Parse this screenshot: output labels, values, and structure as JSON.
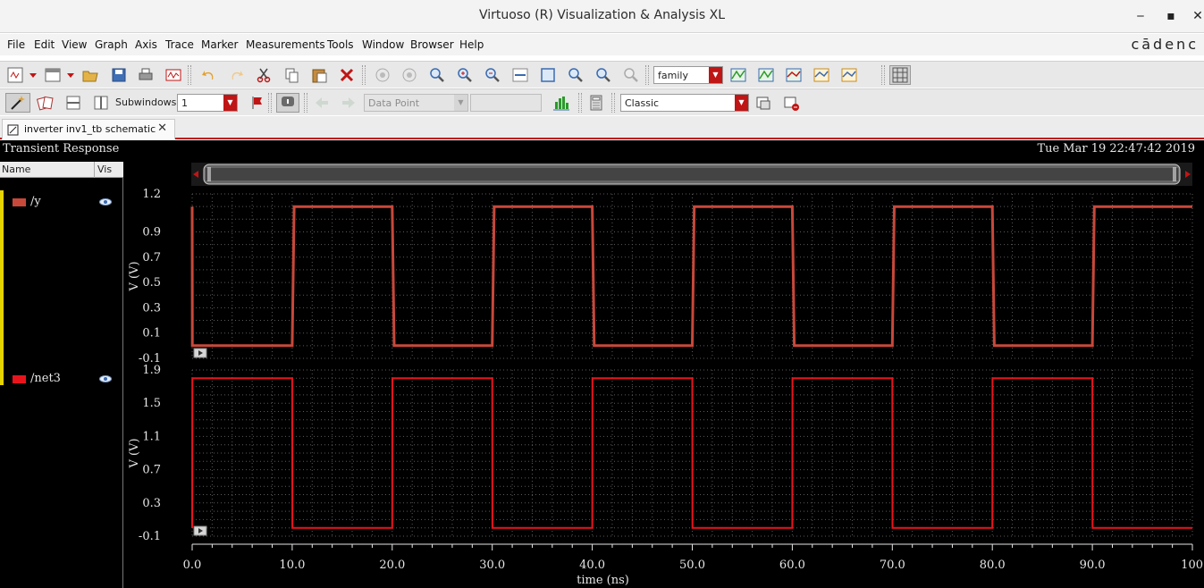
{
  "window": {
    "title": "Virtuoso (R) Visualization & Analysis XL",
    "minimize": "‒",
    "maximize": "▪",
    "close": "✕"
  },
  "menu": {
    "items": [
      "File",
      "Edit",
      "View",
      "Graph",
      "Axis",
      "Trace",
      "Marker",
      "Measurements",
      "Tools",
      "Window",
      "Browser",
      "Help"
    ],
    "logo": "cādenc"
  },
  "toolbar": {
    "family_combo": "family",
    "subwindows_label": "Subwindows:",
    "subwindows_value": "1",
    "data_point_combo": "Data Point",
    "style_combo": "Classic"
  },
  "tab": {
    "label": "inverter inv1_tb schematic",
    "close": "✕"
  },
  "plot": {
    "caption": "Transient Response",
    "date": "Tue Mar 19 22:47:42 2019"
  },
  "trace_panel": {
    "col_name": "Name",
    "col_vis": "Vis",
    "traces": [
      {
        "name": "/y",
        "color": "#c8483a"
      },
      {
        "name": "/net3",
        "color": "#e8141c"
      }
    ]
  },
  "colors": {
    "accent": "#c01515",
    "trace_y": "#c8483a",
    "trace_net3": "#e8141c",
    "grid": "#5a5a5a",
    "background": "#000000"
  },
  "chart_data": [
    {
      "type": "line",
      "series": [
        {
          "name": "/y",
          "x": [
            0,
            0.02,
            10,
            10.2,
            20,
            20.2,
            30,
            30.2,
            40,
            40.2,
            50,
            50.2,
            60,
            60.2,
            70,
            70.2,
            80,
            80.2,
            90,
            90.2,
            100
          ],
          "y": [
            1.1,
            0.0,
            0.0,
            1.1,
            1.1,
            0.0,
            0.0,
            1.1,
            1.1,
            0.0,
            0.0,
            1.1,
            1.1,
            0.0,
            0.0,
            1.1,
            1.1,
            0.0,
            0.0,
            1.1,
            1.1
          ]
        }
      ],
      "ylabel": "V (V)",
      "yticks": [
        "1.2",
        "0.9",
        "0.7",
        "0.5",
        "0.3",
        "0.1",
        "-0.1"
      ],
      "ylim": [
        -0.1,
        1.2
      ],
      "xlim": [
        0,
        100
      ],
      "grid": true
    },
    {
      "type": "line",
      "series": [
        {
          "name": "/net3",
          "x": [
            0,
            0.02,
            10,
            10.02,
            20,
            20.02,
            30,
            30.02,
            40,
            40.02,
            50,
            50.02,
            60,
            60.02,
            70,
            70.02,
            80,
            80.02,
            90,
            90.02,
            100
          ],
          "y": [
            0.0,
            1.8,
            1.8,
            0.0,
            0.0,
            1.8,
            1.8,
            0.0,
            0.0,
            1.8,
            1.8,
            0.0,
            0.0,
            1.8,
            1.8,
            0.0,
            0.0,
            1.8,
            1.8,
            0.0,
            0.0
          ]
        }
      ],
      "ylabel": "V (V)",
      "yticks": [
        "1.9",
        "1.5",
        "1.1",
        "0.7",
        "0.3",
        "-0.1"
      ],
      "ylim": [
        -0.1,
        1.9
      ],
      "xlabel": "time (ns)",
      "xticks": [
        "0.0",
        "10.0",
        "20.0",
        "30.0",
        "40.0",
        "50.0",
        "60.0",
        "70.0",
        "80.0",
        "90.0",
        "100"
      ],
      "xlim": [
        0,
        100
      ],
      "grid": true
    }
  ]
}
